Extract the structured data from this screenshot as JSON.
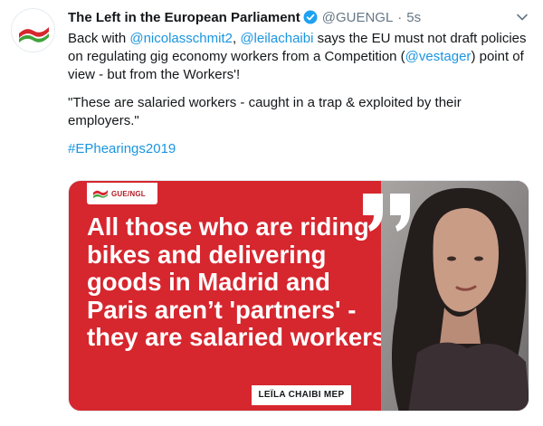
{
  "author": {
    "display_name": "The Left in the European Parliament",
    "handle": "@GUENGL",
    "separator": "·",
    "time": "5s",
    "avatar_icon": "guengl-flag-logo-icon",
    "verified_icon": "verified-badge-icon"
  },
  "menu_icon": "chevron-down-icon",
  "tweet": {
    "line1_pre": "Back with ",
    "mention1": "@nicolasschmit2",
    "line1_mid": ", ",
    "mention2": "@leilachaibi",
    "line1_post": " says the EU must not draft policies on regulating gig economy workers from a Competition (",
    "mention3": "@vestager",
    "line1_end": ") point of view - but from the Workers'!",
    "quote": "\"These are salaried workers - caught in a trap & exploited by their employers.\"",
    "hashtag": "#EPhearings2019"
  },
  "media": {
    "logo_text": "GUE/NGL",
    "headline": "All those who are riding bikes and delivering goods in Madrid and Paris aren’t 'partners' - they are salaried workers!",
    "attribution": "LEÏLA CHAIBI MEP"
  },
  "colors": {
    "link": "#1b95e0",
    "media_red": "#d6262e",
    "verified": "#1da1f2",
    "text": "#14171a",
    "secondary": "#657786"
  }
}
